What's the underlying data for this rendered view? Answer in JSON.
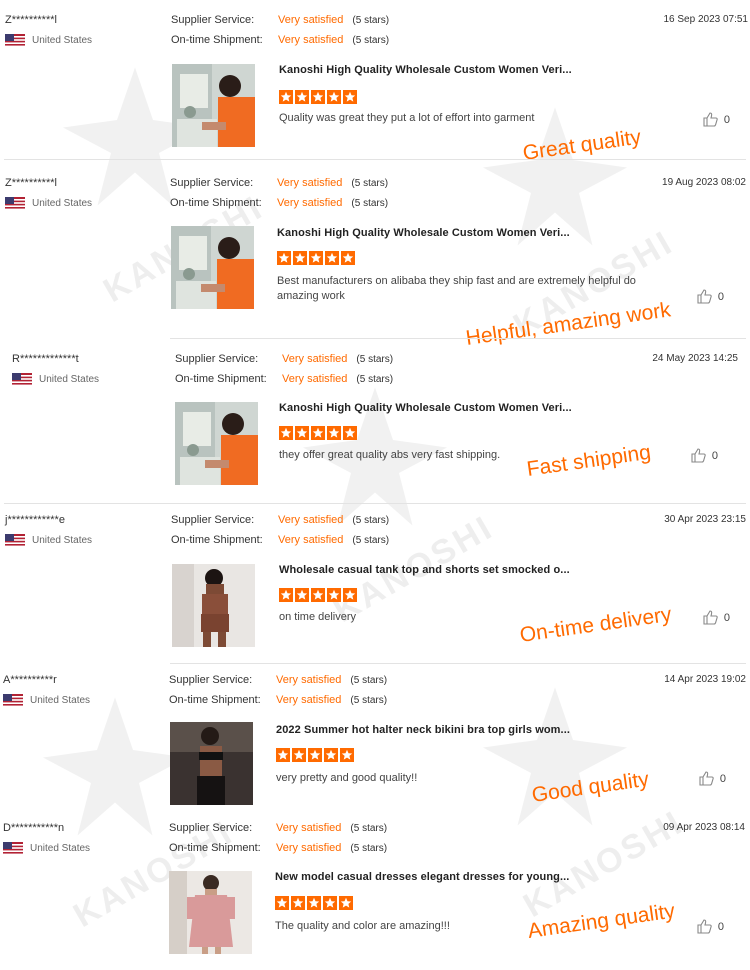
{
  "labels": {
    "supplier_service": "Supplier Service:",
    "ontime_shipment": "On-time Shipment:",
    "watermark": "KANOSHI"
  },
  "colors": {
    "accent": "#ff6a00"
  },
  "reviews": [
    {
      "user": "Z**********l",
      "country": "United States",
      "date": "16 Sep 2023 07:51",
      "supplier_rating": "Very satisfied",
      "supplier_stars": "(5 stars)",
      "shipment_rating": "Very satisfied",
      "shipment_stars": "(5 stars)",
      "product_title": "Kanoshi High Quality Wholesale Custom Women Veri...",
      "rating": 5,
      "comment": "Quality was great they put a lot of effort into garment",
      "likes": "0",
      "overlay": "Great quality",
      "image": "sewing"
    },
    {
      "user": "Z**********l",
      "country": "United States",
      "date": "19 Aug 2023 08:02",
      "supplier_rating": "Very satisfied",
      "supplier_stars": "(5 stars)",
      "shipment_rating": "Very satisfied",
      "shipment_stars": "(5 stars)",
      "product_title": "Kanoshi High Quality Wholesale Custom Women Veri...",
      "rating": 5,
      "comment": "Best manufacturers on alibaba they ship fast and are extremely helpful do amazing work",
      "likes": "0",
      "overlay": "Helpful, amazing work",
      "image": "sewing"
    },
    {
      "user": "R*************t",
      "country": "United States",
      "date": "24 May 2023 14:25",
      "supplier_rating": "Very satisfied",
      "supplier_stars": "(5 stars)",
      "shipment_rating": "Very satisfied",
      "shipment_stars": "(5 stars)",
      "product_title": "Kanoshi High Quality Wholesale Custom Women Veri...",
      "rating": 5,
      "comment": "they offer great quality abs very fast shipping.",
      "likes": "0",
      "overlay": "Fast shipping",
      "image": "sewing"
    },
    {
      "user": "j************e",
      "country": "United States",
      "date": "30 Apr 2023 23:15",
      "supplier_rating": "Very satisfied",
      "supplier_stars": "(5 stars)",
      "shipment_rating": "Very satisfied",
      "shipment_stars": "(5 stars)",
      "product_title": "Wholesale casual tank top and shorts set smocked o...",
      "rating": 5,
      "comment": "on time delivery",
      "likes": "0",
      "overlay": "On-time delivery",
      "image": "brownset"
    },
    {
      "user": "A**********r",
      "country": "United States",
      "date": "14 Apr 2023 19:02",
      "supplier_rating": "Very satisfied",
      "supplier_stars": "(5 stars)",
      "shipment_rating": "Very satisfied",
      "shipment_stars": "(5 stars)",
      "product_title": "2022 Summer hot halter neck bikini bra top girls wom...",
      "rating": 5,
      "comment": "very pretty and good quality!!",
      "likes": "0",
      "overlay": "Good quality",
      "image": "bikini"
    },
    {
      "user": "D***********n",
      "country": "United States",
      "date": "09 Apr 2023 08:14",
      "supplier_rating": "Very satisfied",
      "supplier_stars": "(5 stars)",
      "shipment_rating": "Very satisfied",
      "shipment_stars": "(5 stars)",
      "product_title": "New model casual dresses elegant dresses for young...",
      "rating": 5,
      "comment": "The quality and color are amazing!!!",
      "likes": "0",
      "overlay": "Amazing quality",
      "image": "pinkdress"
    }
  ]
}
